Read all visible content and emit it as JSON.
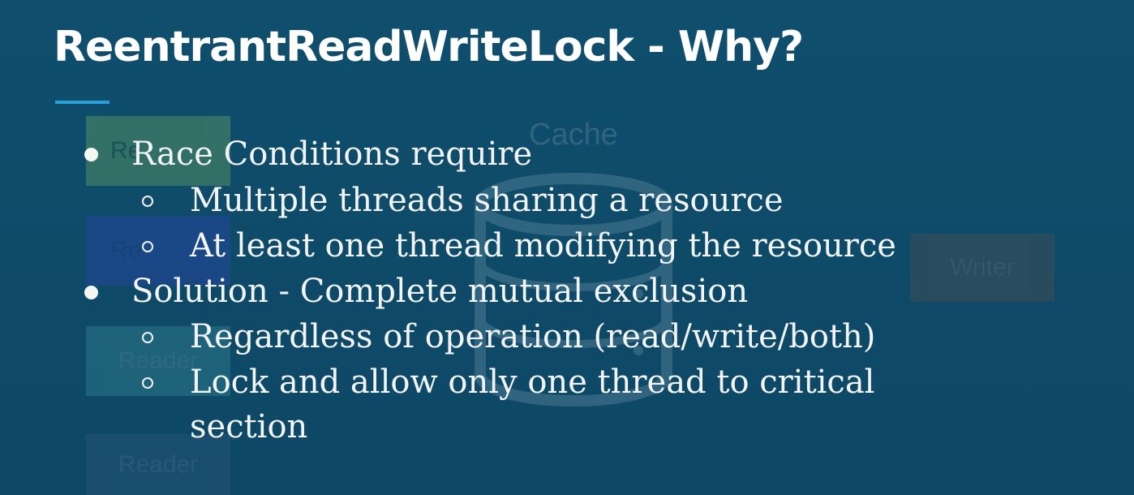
{
  "slide": {
    "title": "ReentrantReadWriteLock - Why?",
    "accent_color": "#2a9fd8",
    "background_color": "#0f4b6a"
  },
  "background_diagram": {
    "cache_label": "Cache",
    "reader_labels": [
      "Re",
      "Re",
      "Reader",
      "Reader"
    ],
    "writer_label": "Writer"
  },
  "bullets": [
    {
      "text": "Race Conditions require",
      "children": [
        "Multiple threads sharing a resource",
        "At least one thread modifying the resource"
      ]
    },
    {
      "text": "Solution - Complete mutual exclusion",
      "children": [
        "Regardless of operation (read/write/both)",
        "Lock and allow only one thread to critical",
        "section"
      ]
    }
  ]
}
